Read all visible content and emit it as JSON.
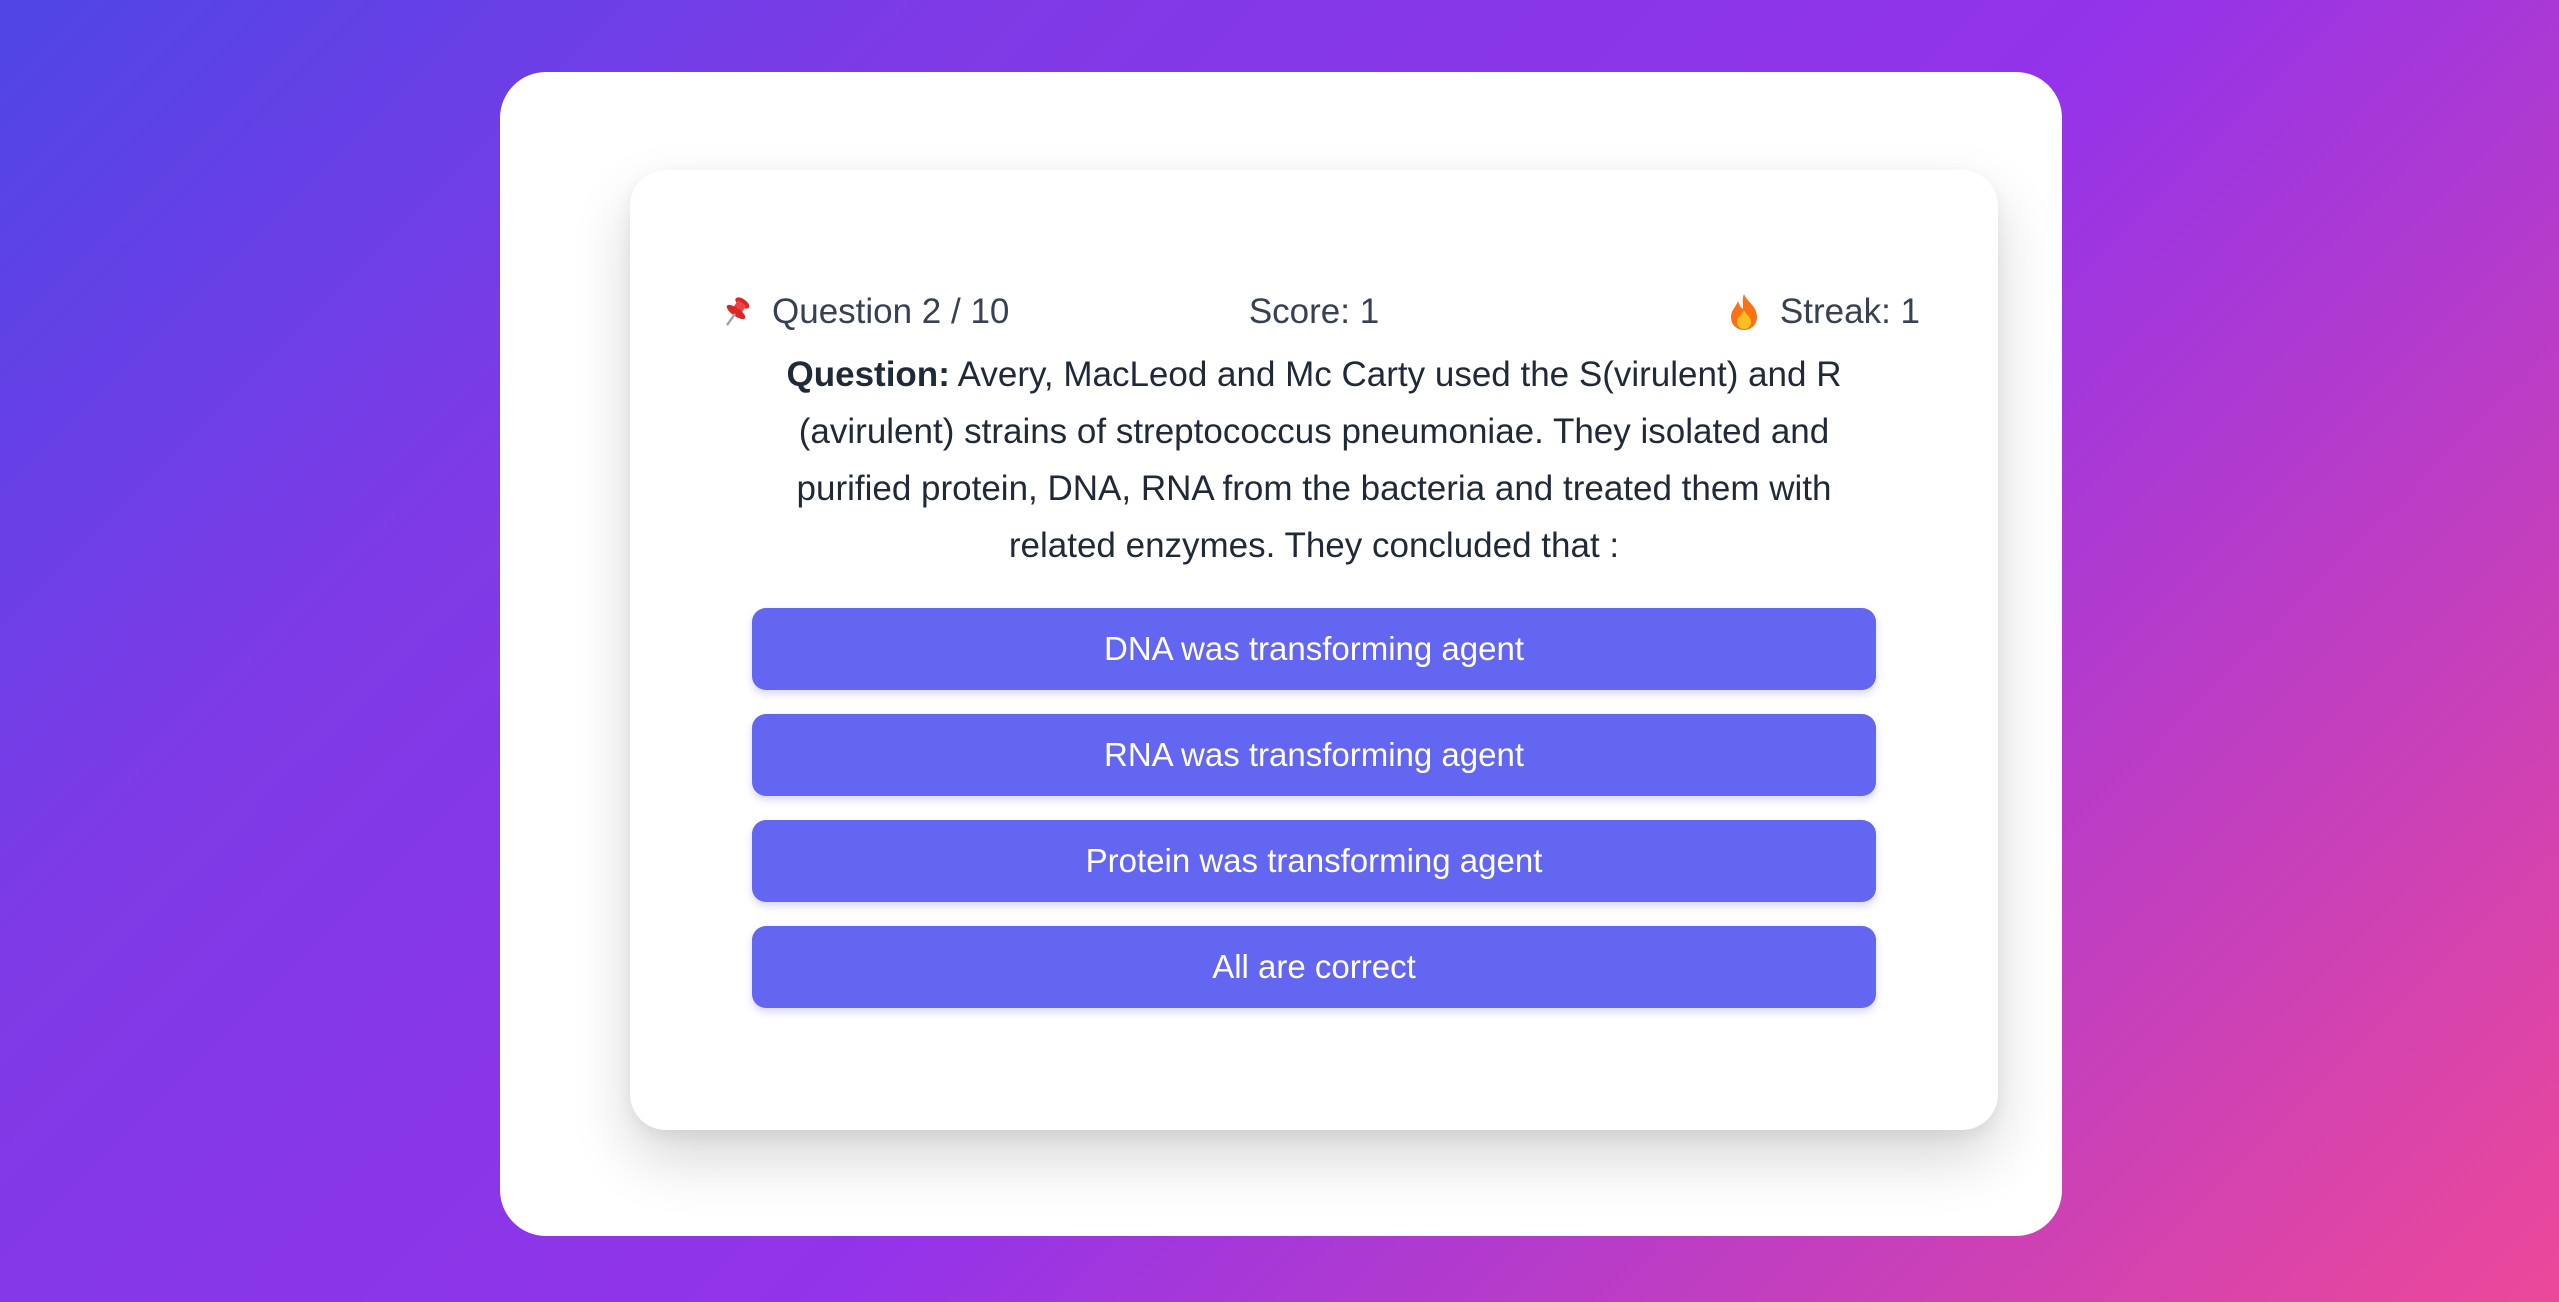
{
  "stats": {
    "question_progress": "Question 2 / 10",
    "score": "Score: 1",
    "streak": "Streak: 1",
    "progress_icon": "pushpin-icon",
    "streak_icon": "fire-icon"
  },
  "question": {
    "label": "Question:",
    "text": "Avery, MacLeod and Mc Carty used the S(virulent) and R (avirulent) strains of streptococcus pneumoniae. They isolated and purified protein, DNA, RNA from the bacteria and treated them with related enzymes. They concluded that :"
  },
  "options": [
    "DNA was transforming agent",
    "RNA was transforming agent",
    "Protein was transforming agent",
    "All are correct"
  ],
  "colors": {
    "option_bg": "#6366f1",
    "gradient_start": "#4f46e5",
    "gradient_end": "#ec4899"
  }
}
